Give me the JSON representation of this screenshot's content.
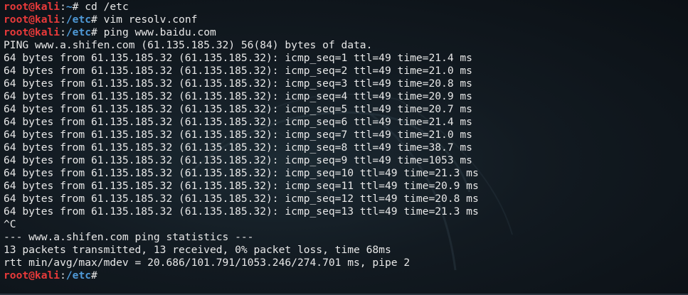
{
  "prompt": {
    "user": "root@kali",
    "colon": ":",
    "symbol": "# "
  },
  "lines": [
    {
      "type": "prompt",
      "path": "~",
      "command": "cd /etc"
    },
    {
      "type": "prompt",
      "path": "/etc",
      "command": "vim resolv.conf"
    },
    {
      "type": "prompt",
      "path": "/etc",
      "command": "ping www.baidu.com"
    },
    {
      "type": "output",
      "text": "PING www.a.shifen.com (61.135.185.32) 56(84) bytes of data."
    },
    {
      "type": "output",
      "text": "64 bytes from 61.135.185.32 (61.135.185.32): icmp_seq=1 ttl=49 time=21.4 ms"
    },
    {
      "type": "output",
      "text": "64 bytes from 61.135.185.32 (61.135.185.32): icmp_seq=2 ttl=49 time=21.0 ms"
    },
    {
      "type": "output",
      "text": "64 bytes from 61.135.185.32 (61.135.185.32): icmp_seq=3 ttl=49 time=20.8 ms"
    },
    {
      "type": "output",
      "text": "64 bytes from 61.135.185.32 (61.135.185.32): icmp_seq=4 ttl=49 time=20.9 ms"
    },
    {
      "type": "output",
      "text": "64 bytes from 61.135.185.32 (61.135.185.32): icmp_seq=5 ttl=49 time=20.7 ms"
    },
    {
      "type": "output",
      "text": "64 bytes from 61.135.185.32 (61.135.185.32): icmp_seq=6 ttl=49 time=21.4 ms"
    },
    {
      "type": "output",
      "text": "64 bytes from 61.135.185.32 (61.135.185.32): icmp_seq=7 ttl=49 time=21.0 ms"
    },
    {
      "type": "output",
      "text": "64 bytes from 61.135.185.32 (61.135.185.32): icmp_seq=8 ttl=49 time=38.7 ms"
    },
    {
      "type": "output",
      "text": "64 bytes from 61.135.185.32 (61.135.185.32): icmp_seq=9 ttl=49 time=1053 ms"
    },
    {
      "type": "output",
      "text": "64 bytes from 61.135.185.32 (61.135.185.32): icmp_seq=10 ttl=49 time=21.3 ms"
    },
    {
      "type": "output",
      "text": "64 bytes from 61.135.185.32 (61.135.185.32): icmp_seq=11 ttl=49 time=20.9 ms"
    },
    {
      "type": "output",
      "text": "64 bytes from 61.135.185.32 (61.135.185.32): icmp_seq=12 ttl=49 time=20.8 ms"
    },
    {
      "type": "output",
      "text": "64 bytes from 61.135.185.32 (61.135.185.32): icmp_seq=13 ttl=49 time=21.3 ms"
    },
    {
      "type": "output",
      "text": "^C"
    },
    {
      "type": "output",
      "text": "--- www.a.shifen.com ping statistics ---"
    },
    {
      "type": "output",
      "text": "13 packets transmitted, 13 received, 0% packet loss, time 68ms"
    },
    {
      "type": "output",
      "text": "rtt min/avg/max/mdev = 20.686/101.791/1053.246/274.701 ms, pipe 2"
    },
    {
      "type": "prompt",
      "path": "/etc",
      "command": ""
    }
  ],
  "colors": {
    "background": "#121a21",
    "text": "#e8e8e8",
    "user": "#e83a3a",
    "path": "#4f9ad8"
  },
  "icons": {
    "wallpaper": "kali-dragon-watermark"
  }
}
